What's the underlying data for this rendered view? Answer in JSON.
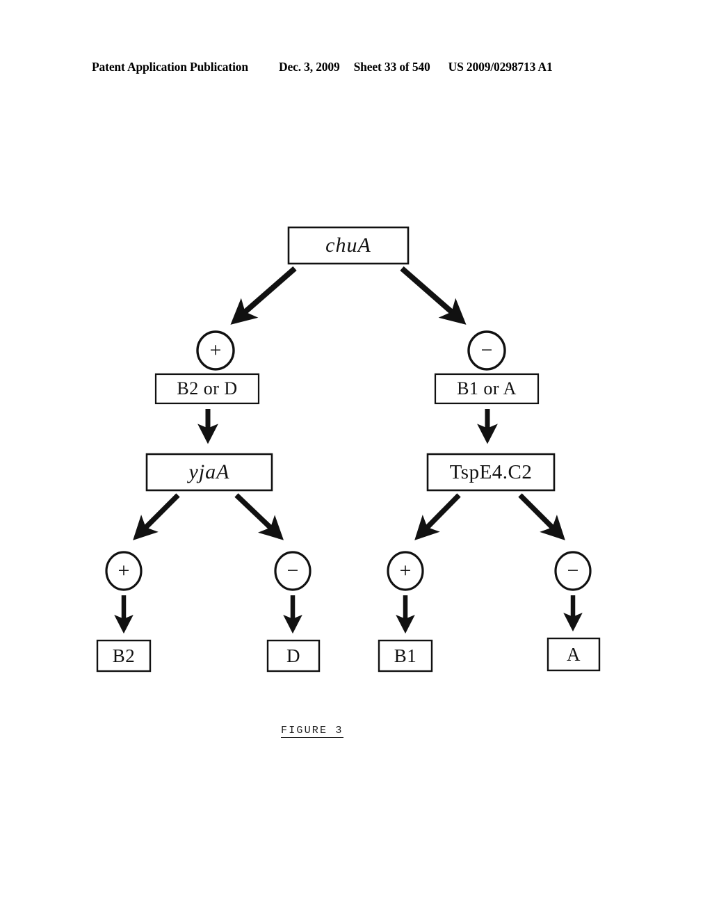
{
  "header": {
    "publication": "Patent Application Publication",
    "date": "Dec. 3, 2009",
    "sheet": "Sheet 33 of 540",
    "patent_number": "US 2009/0298713 A1"
  },
  "figure": {
    "caption": "FIGURE 3",
    "ink_color": "#111111",
    "background_color": "#ffffff"
  },
  "diagram": {
    "type": "decision-tree",
    "root": {
      "id": "chuA",
      "label": "chuA",
      "style": "italic-gene-box"
    },
    "level1": [
      {
        "id": "chuA-plus",
        "sign": "+",
        "sign_name": "plus-circle",
        "result_label": "B2 or D"
      },
      {
        "id": "chuA-minus",
        "sign": "−",
        "sign_name": "minus-circle",
        "result_label": "B1 or A"
      }
    ],
    "level2": [
      {
        "id": "yjaA",
        "label": "yjaA",
        "style": "italic-gene-box"
      },
      {
        "id": "TspE4.C2",
        "label": "TspE4.C2",
        "style": "upright-gene-box"
      }
    ],
    "level3": [
      {
        "id": "yjaA-plus",
        "sign": "+",
        "sign_name": "plus-circle",
        "result_label": "B2"
      },
      {
        "id": "yjaA-minus",
        "sign": "−",
        "sign_name": "minus-circle",
        "result_label": "D"
      },
      {
        "id": "tspe4-plus",
        "sign": "+",
        "sign_name": "plus-circle",
        "result_label": "B1"
      },
      {
        "id": "tspe4-minus",
        "sign": "−",
        "sign_name": "minus-circle",
        "result_label": "A"
      }
    ]
  }
}
